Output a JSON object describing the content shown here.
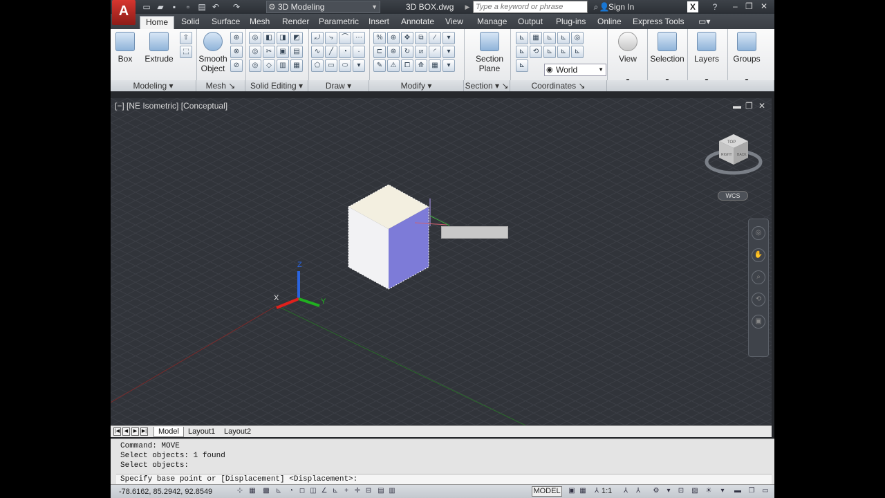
{
  "app": {
    "logo_letter": "A",
    "workspace": "3D Modeling",
    "file_name": "3D BOX.dwg",
    "search_placeholder": "Type a keyword or phrase",
    "sign_in": "Sign In"
  },
  "tabs": [
    {
      "label": "Home",
      "active": true
    },
    {
      "label": "Solid"
    },
    {
      "label": "Surface"
    },
    {
      "label": "Mesh"
    },
    {
      "label": "Render"
    },
    {
      "label": "Parametric"
    },
    {
      "label": "Insert"
    },
    {
      "label": "Annotate"
    },
    {
      "label": "View"
    },
    {
      "label": "Manage"
    },
    {
      "label": "Output"
    },
    {
      "label": "Plug-ins"
    },
    {
      "label": "Online"
    },
    {
      "label": "Express Tools"
    }
  ],
  "ribbon": {
    "box": "Box",
    "extrude": "Extrude",
    "smooth_object": "Smooth Object",
    "section_plane": "Section Plane",
    "world": "World",
    "view": "View",
    "selection": "Selection",
    "layers": "Layers",
    "groups": "Groups",
    "panels": {
      "modeling": "Modeling",
      "mesh": "Mesh",
      "solid_editing": "Solid Editing",
      "draw": "Draw",
      "modify": "Modify",
      "section": "Section",
      "coordinates": "Coordinates"
    }
  },
  "viewport": {
    "label": "[−] [NE Isometric] [Conceptual]",
    "wcs": "WCS",
    "cube_faces": [
      "TOP",
      "RIGHT",
      "BACK"
    ],
    "axis_x": "X",
    "axis_y": "Y",
    "axis_z": "Z"
  },
  "layout_tabs": [
    "Model",
    "Layout1",
    "Layout2"
  ],
  "command": {
    "lines": "Command: MOVE\nSelect objects: 1 found\nSelect objects:",
    "prompt": "Specify base point or [Displacement] <Displacement>:"
  },
  "status": {
    "coords": "-78.6162, 85.2942, 92.8549",
    "model": "MODEL",
    "scale": "1:1"
  },
  "colors": {
    "box_top": "#f3efe0",
    "box_left": "#f2f2f4",
    "box_right": "#7d7bd8",
    "axis_x": "#e0201c",
    "axis_y": "#20b020",
    "axis_z": "#2a64e0"
  }
}
